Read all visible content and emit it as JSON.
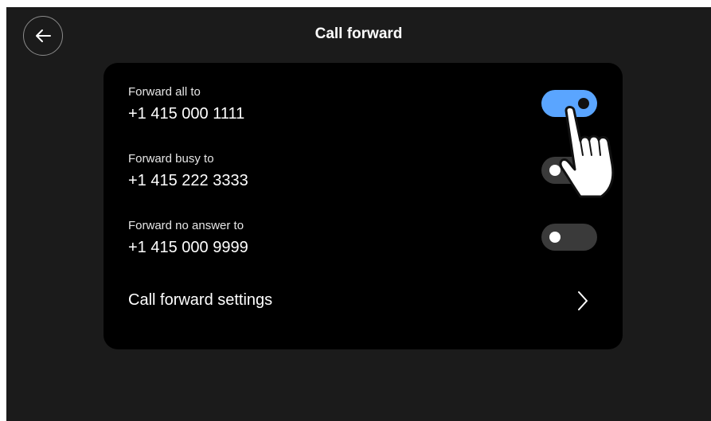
{
  "header": {
    "title": "Call forward",
    "back_icon": "arrow-left-icon"
  },
  "rows": [
    {
      "label": "Forward all to",
      "number": "+1 415 000 1111",
      "enabled": true
    },
    {
      "label": "Forward busy to",
      "number": "+1 415 222 3333",
      "enabled": false
    },
    {
      "label": "Forward no answer to",
      "number": "+1 415 000 9999",
      "enabled": false
    }
  ],
  "settings": {
    "label": "Call forward settings",
    "icon": "chevron-right-icon"
  },
  "overlay": {
    "icon": "pointing-hand-icon"
  },
  "colors": {
    "screen_bg": "#1b1b1b",
    "card_bg": "#000000",
    "toggle_on": "#5aa5ff",
    "toggle_off": "#3a3a3a"
  }
}
